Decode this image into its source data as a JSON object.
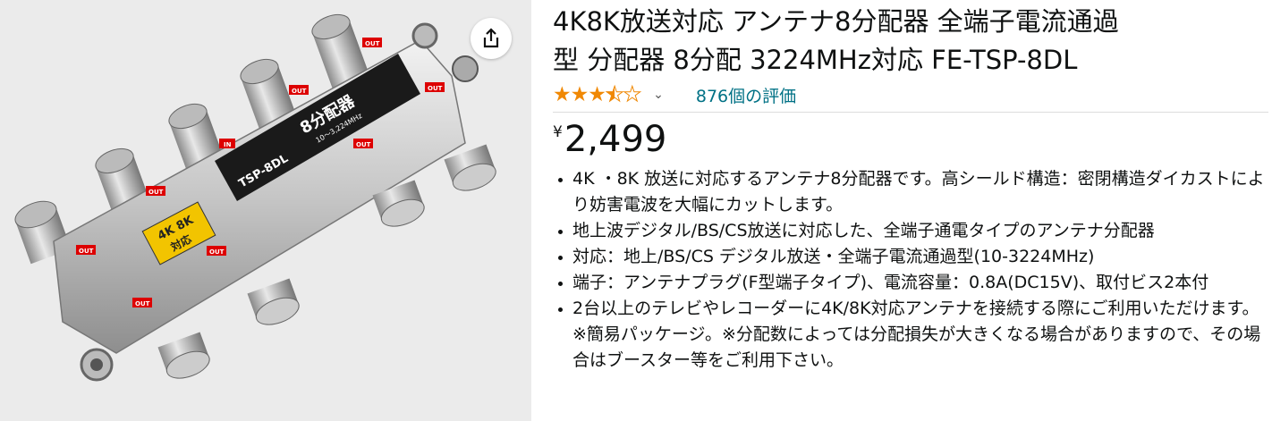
{
  "product": {
    "title_line1": "4K8K放送対応 アンテナ8分配器 全端子電流通過",
    "title_line2": "型 分配器 8分配 3224MHz対応 FE-TSP-8DL",
    "rating": 3.5,
    "ratings_count": "876個の評価",
    "price_symbol": "¥",
    "price_amount": "2,499",
    "bullets": [
      "4K ・8K 放送に対応するアンテナ8分配器です。高シールド構造：密閉構造ダイカストにより妨害電波を大幅にカットします。",
      "地上波デジタル/BS/CS放送に対応した、全端子通電タイプのアンテナ分配器",
      "対応：地上/BS/CS デジタル放送・全端子電流通過型(10-3224MHz)",
      "端子：アンテナプラグ(F型端子タイプ)、電流容量：0.8A(DC15V)、取付ビス2本付",
      "2台以上のテレビやレコーダーに4K/8K対応アンテナを接続する際にご利用いただけます。 ※簡易パッケージ。※分配数によっては分配損失が大きくなる場合がありますので、その場合はブースター等をご利用下さい。"
    ]
  },
  "image": {
    "label_main": "8分配器",
    "label_range": "10～3,224MHz",
    "label_model": "TSP-8DL",
    "badge_line1": "4K 8K",
    "badge_line2": "対応",
    "port_out": "OUT",
    "port_in": "IN"
  },
  "icons": {
    "share": "share-icon",
    "chevron": "chevron-down-icon",
    "star": "star-icon"
  },
  "colors": {
    "star": "#f08804",
    "link": "#007185",
    "text": "#0f1111"
  }
}
